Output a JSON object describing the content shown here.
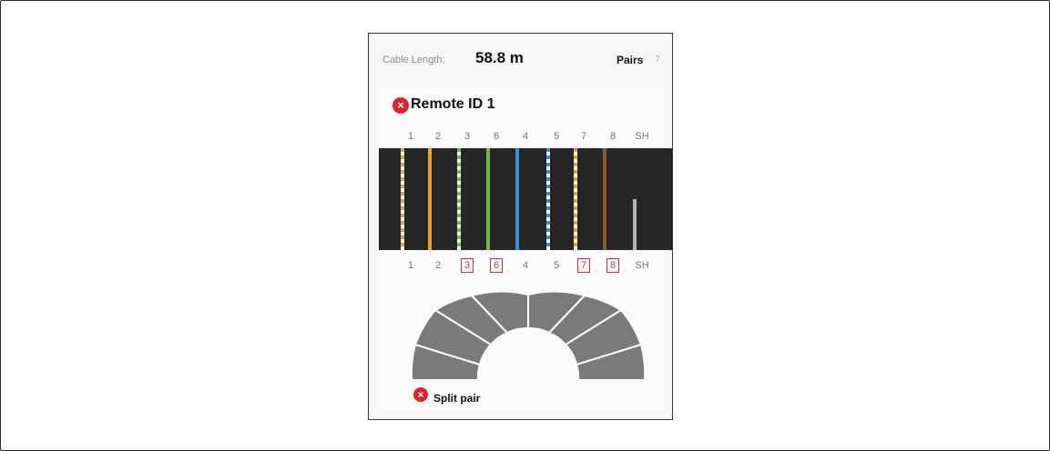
{
  "cable": {
    "length_label": "Cable Length:",
    "length_value": "58.8 m",
    "mode_label": "Pairs",
    "help_glyph": "?"
  },
  "remote": {
    "status_icon": "error-x-icon",
    "title": "Remote ID 1"
  },
  "wiremap": {
    "top_labels": [
      "1",
      "2",
      "3",
      "6",
      "4",
      "5",
      "7",
      "8",
      "SH"
    ],
    "bottom_labels": [
      "1",
      "2",
      "3",
      "6",
      "4",
      "5",
      "7",
      "8",
      "SH"
    ],
    "bottom_faulted": [
      false,
      false,
      true,
      true,
      false,
      false,
      true,
      true,
      false
    ],
    "wire_colors": {
      "orange": "#f2a02a",
      "green": "#6cc04a",
      "blue": "#3a8fdc",
      "brown": "#8a5a2a",
      "white": "#ffffff",
      "shield": "#b5b5b5"
    },
    "fault_box_color": "#e02030"
  },
  "diagnosis": {
    "status_icon": "error-x-icon",
    "label": "Split pair",
    "segment_color": "#7a7a7a",
    "error_color": "#e0202c"
  }
}
